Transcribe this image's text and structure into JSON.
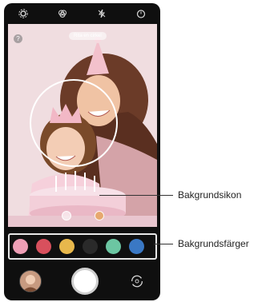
{
  "topbar": {
    "icons": [
      "settings-icon",
      "filter-icon",
      "flash-off-icon",
      "timer-icon"
    ]
  },
  "viewfinder": {
    "hint": "Rita en cirkel",
    "help": "?"
  },
  "background_colors": [
    "#ef9fb6",
    "#d8505d",
    "#e8b84c",
    "#2a2a2a",
    "#6cc6a2",
    "#3a78c4"
  ],
  "callouts": {
    "background_icon": "Bakgrundsikon",
    "background_colors": "Bakgrundsfärger"
  }
}
